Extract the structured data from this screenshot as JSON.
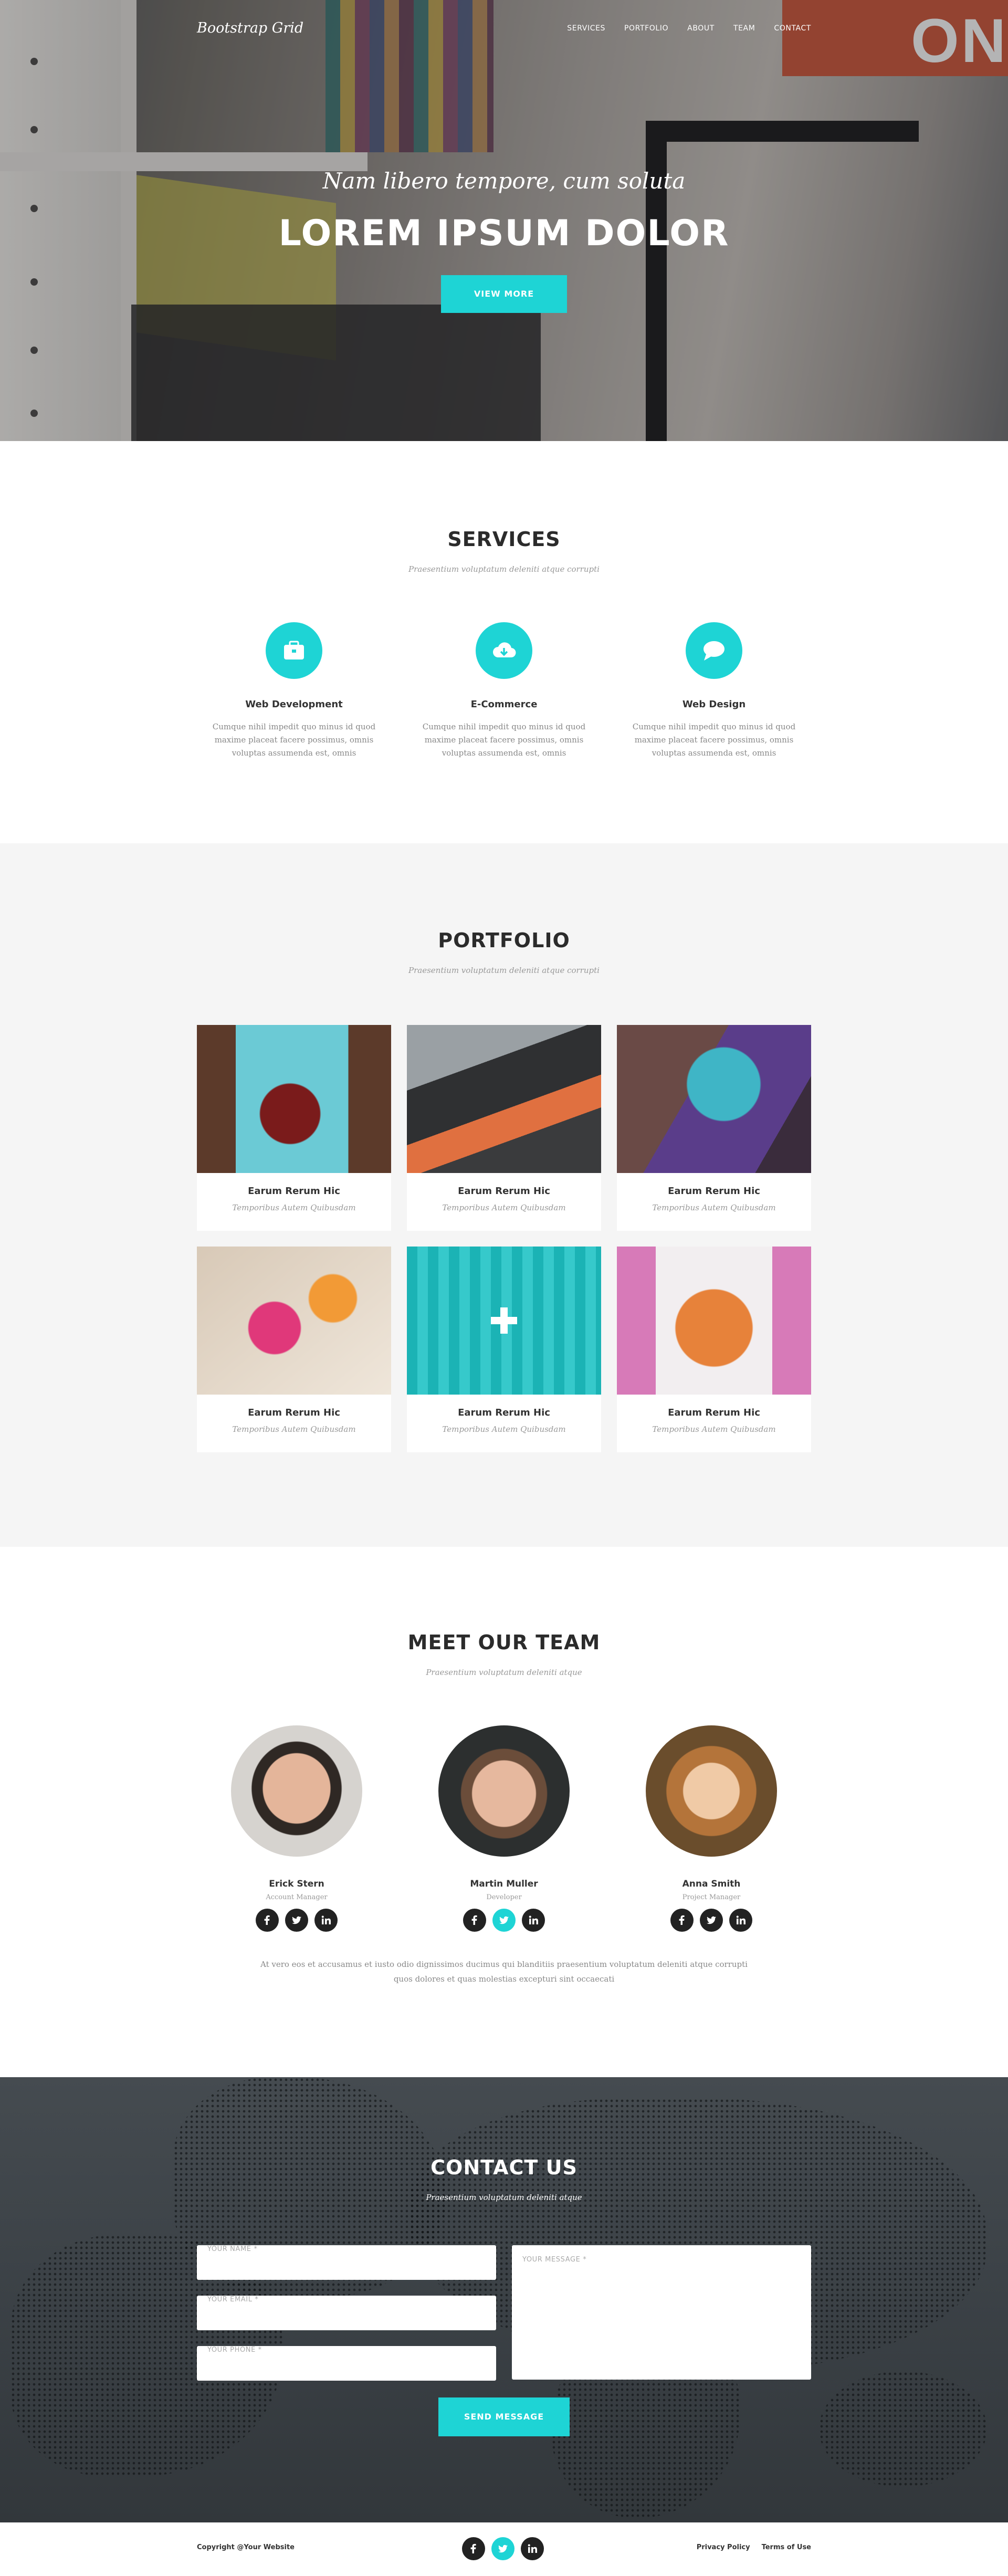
{
  "header": {
    "brand": "Bootstrap Grid",
    "nav": [
      "SERVICES",
      "PORTFOLIO",
      "ABOUT",
      "TEAM",
      "CONTACT"
    ]
  },
  "hero": {
    "subtitle": "Nam libero tempore, cum soluta",
    "title": "LOREM IPSUM DOLOR",
    "button": "VIEW MORE",
    "sign_text": "ON"
  },
  "services": {
    "title": "SERVICES",
    "subtitle": "Praesentium voluptatum deleniti atque corrupti",
    "items": [
      {
        "icon": "briefcase-icon",
        "title": "Web Development",
        "text": "Cumque nihil impedit quo minus id quod maxime placeat facere possimus, omnis voluptas assumenda est, omnis"
      },
      {
        "icon": "cloud-download-icon",
        "title": "E-Commerce",
        "text": "Cumque nihil impedit quo minus id quod maxime placeat facere possimus, omnis voluptas assumenda est, omnis"
      },
      {
        "icon": "chat-bubble-icon",
        "title": "Web Design",
        "text": "Cumque nihil impedit quo minus id quod maxime placeat facere possimus, omnis voluptas assumenda est, omnis"
      }
    ]
  },
  "portfolio": {
    "title": "PORTFOLIO",
    "subtitle": "Praesentium voluptatum deleniti atque corrupti",
    "items": [
      {
        "title": "Earum Rerum Hic",
        "subtitle": "Temporibus Autem Quibusdam"
      },
      {
        "title": "Earum Rerum Hic",
        "subtitle": "Temporibus Autem Quibusdam"
      },
      {
        "title": "Earum Rerum Hic",
        "subtitle": "Temporibus Autem Quibusdam"
      },
      {
        "title": "Earum Rerum Hic",
        "subtitle": "Temporibus Autem Quibusdam"
      },
      {
        "title": "Earum Rerum Hic",
        "subtitle": "Temporibus Autem Quibusdam"
      },
      {
        "title": "Earum Rerum Hic",
        "subtitle": "Temporibus Autem Quibusdam"
      }
    ]
  },
  "team": {
    "title": "MEET OUR TEAM",
    "subtitle": "Praesentium voluptatum deleniti atque",
    "members": [
      {
        "name": "Erick Stern",
        "role": "Account Manager"
      },
      {
        "name": "Martin Muller",
        "role": "Developer"
      },
      {
        "name": "Anna Smith",
        "role": "Project Manager"
      }
    ],
    "text": "At vero eos et accusamus et iusto odio dignissimos ducimus qui blanditiis praesentium voluptatum deleniti atque corrupti quos dolores et quas molestias excepturi sint occaecati"
  },
  "contact": {
    "title": "CONTACT US",
    "subtitle": "Praesentium voluptatum deleniti atque",
    "name_placeholder": "YOUR NAME *",
    "email_placeholder": "YOUR EMAIL *",
    "phone_placeholder": "YOUR PHONE *",
    "message_placeholder": "YOUR MESSAGE *",
    "button": "SEND MESSAGE"
  },
  "footer": {
    "copyright": "Copyright @Your Website",
    "links": [
      "Privacy Policy",
      "Terms of Use"
    ]
  },
  "colors": {
    "accent": "#1ed4d5",
    "dark": "#222222",
    "section_gray": "#f5f5f5",
    "contact_bg": "#3b4146"
  }
}
